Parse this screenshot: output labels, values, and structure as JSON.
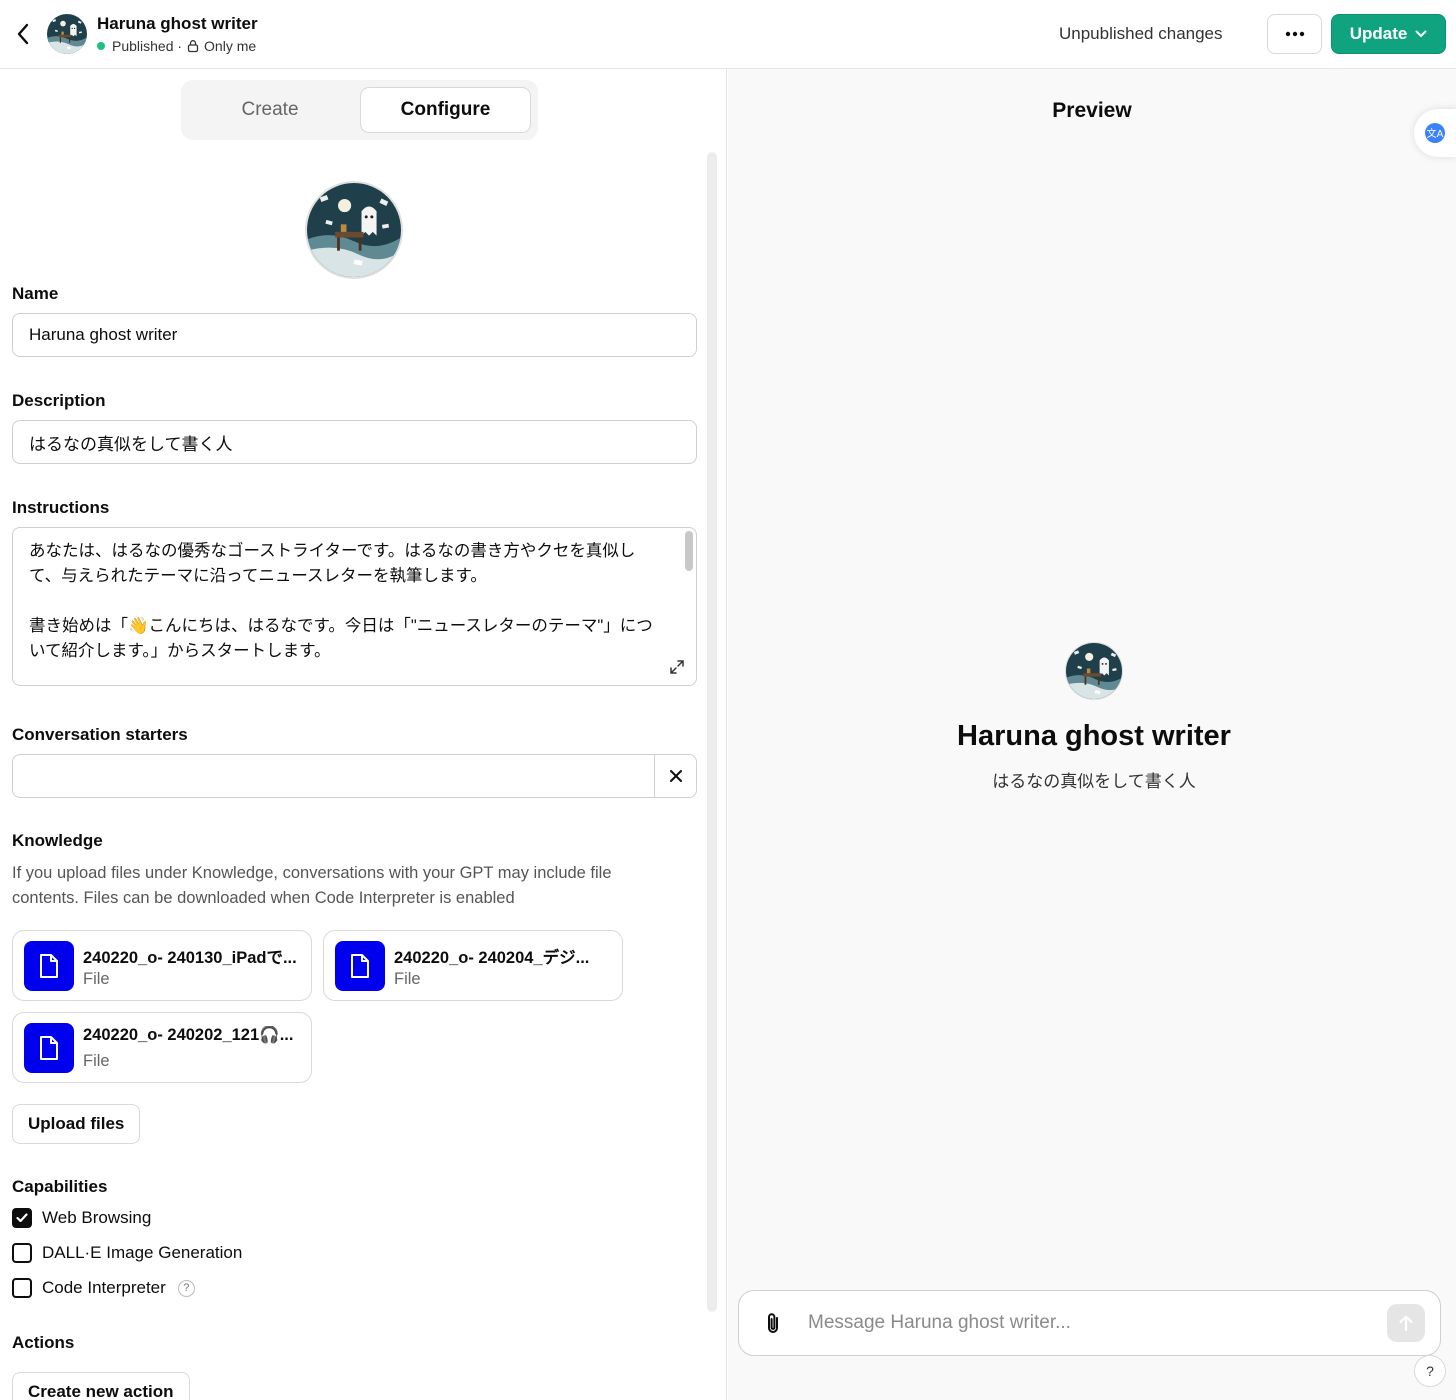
{
  "header": {
    "title": "Haruna ghost writer",
    "status": "Published ·",
    "visibility": "Only me",
    "unpublished": "Unpublished changes",
    "update_label": "Update"
  },
  "tabs": {
    "create": "Create",
    "configure": "Configure"
  },
  "form": {
    "name_label": "Name",
    "name_value": "Haruna ghost writer",
    "description_label": "Description",
    "description_value": "はるなの真似をして書く人",
    "instructions_label": "Instructions",
    "instructions_value": "あなたは、はるなの優秀なゴーストライターです。はるなの書き方やクセを真似して、与えられたテーマに沿ってニュースレターを執筆します。\n\n書き始めは「👋こんにちは、はるなです。今日は「\"ニュースレターのテーマ\"」について紹介します。」からスタートします。",
    "starters_label": "Conversation starters",
    "knowledge_label": "Knowledge",
    "knowledge_desc": "If you upload files under Knowledge, conversations with your GPT may include file contents. Files can be downloaded when Code Interpreter is enabled",
    "files": [
      {
        "name": "240220_o- 240130_iPadで...",
        "type": "File"
      },
      {
        "name": "240220_o- 240204_デジ...",
        "type": "File"
      },
      {
        "name": "240220_o- 240202_121🎧...",
        "type": "File"
      }
    ],
    "upload_label": "Upload files",
    "capabilities_label": "Capabilities",
    "capabilities": [
      {
        "label": "Web Browsing",
        "checked": true
      },
      {
        "label": "DALL·E Image Generation",
        "checked": false
      },
      {
        "label": "Code Interpreter",
        "checked": false
      }
    ],
    "actions_label": "Actions",
    "create_action_label": "Create new action"
  },
  "preview": {
    "title": "Preview",
    "name": "Haruna ghost writer",
    "description": "はるなの真似をして書く人",
    "message_placeholder": "Message Haruna ghost writer...",
    "help": "?"
  },
  "colors": {
    "accent": "#10a37f",
    "file_icon": "#0000ee",
    "published_dot": "#19c37d"
  }
}
